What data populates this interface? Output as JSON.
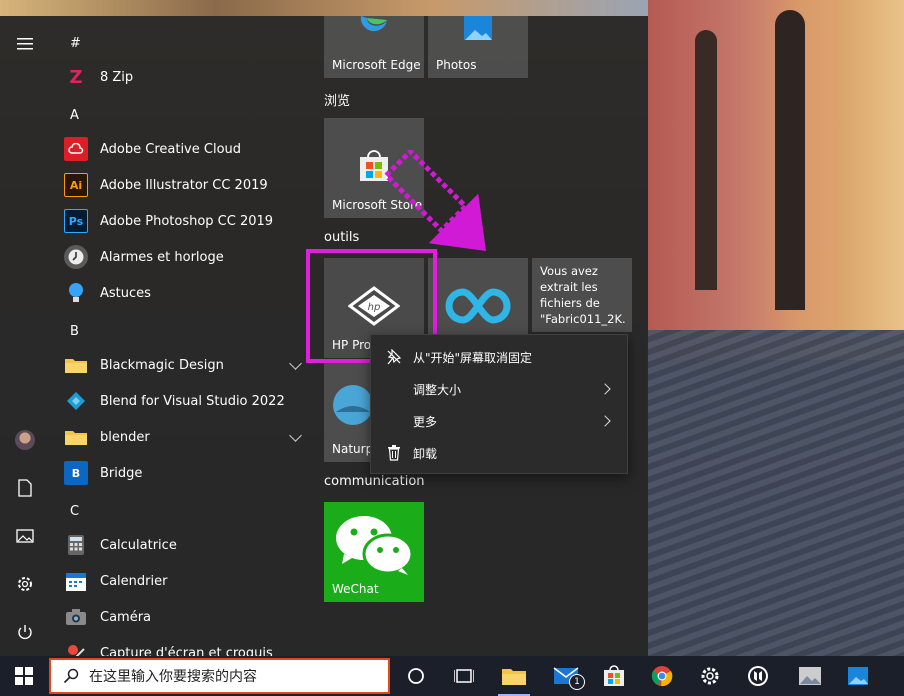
{
  "start_menu": {
    "headers": {
      "hash": "#",
      "a": "A",
      "b": "B",
      "c": "C"
    },
    "apps": [
      {
        "label": "8 Zip",
        "icon": "8zip-icon"
      },
      {
        "label": "Adobe Creative Cloud",
        "icon": "creative-cloud-icon"
      },
      {
        "label": "Adobe Illustrator CC 2019",
        "icon": "illustrator-icon",
        "glyph": "Ai"
      },
      {
        "label": "Adobe Photoshop CC 2019",
        "icon": "photoshop-icon",
        "glyph": "Ps"
      },
      {
        "label": "Alarmes et horloge",
        "icon": "alarm-clock-icon"
      },
      {
        "label": "Astuces",
        "icon": "lightbulb-icon"
      },
      {
        "label": "Blackmagic Design",
        "icon": "folder-icon"
      },
      {
        "label": "Blend for Visual Studio 2022",
        "icon": "blend-icon"
      },
      {
        "label": "blender",
        "icon": "folder-icon"
      },
      {
        "label": "Bridge",
        "icon": "bridge-icon",
        "glyph": "B"
      },
      {
        "label": "Calculatrice",
        "icon": "calculator-icon"
      },
      {
        "label": "Calendrier",
        "icon": "calendar-icon"
      },
      {
        "label": "Caméra",
        "icon": "camera-icon"
      },
      {
        "label": "Capture d'écran et croquis",
        "icon": "snip-sketch-icon"
      }
    ],
    "groups": {
      "browse": "浏览",
      "tools": "outils",
      "communication": "communication"
    },
    "tiles": {
      "edge": "Microsoft Edge",
      "photos": "Photos",
      "store": "Microsoft Store",
      "hp": "HP Pro",
      "naturpic": "Naturp",
      "notification": "Vous avez extrait les fichiers de \"Fabric011_2K...",
      "wechat": "WeChat",
      "hp_logo": "hp"
    }
  },
  "context_menu": {
    "unpin": "从\"开始\"屏幕取消固定",
    "resize": "调整大小",
    "more": "更多",
    "uninstall": "卸载"
  },
  "taskbar": {
    "search_placeholder": "在这里输入你要搜索的内容",
    "mail_badge": "1"
  },
  "colors": {
    "highlight": "#e11ee0",
    "search_border": "#e0491b",
    "wechat_green": "#1aad19"
  }
}
